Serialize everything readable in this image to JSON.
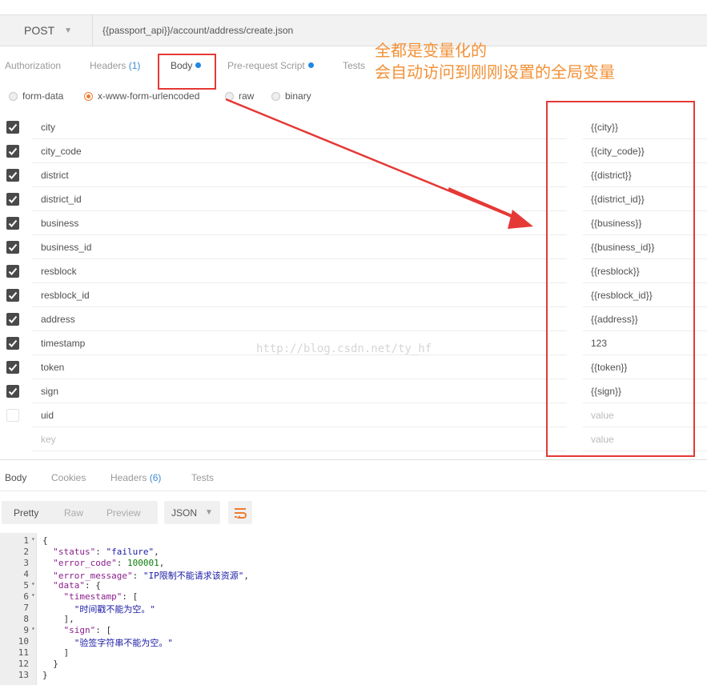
{
  "request": {
    "method": "POST",
    "url": "{{passport_api}}/account/address/create.json"
  },
  "request_tabs": [
    {
      "label": "Authorization",
      "count": "",
      "dot": false,
      "active": false
    },
    {
      "label": "Headers",
      "count": "(1)",
      "dot": false,
      "active": false
    },
    {
      "label": "Body",
      "count": "",
      "dot": true,
      "active": true
    },
    {
      "label": "Pre-request Script",
      "count": "",
      "dot": true,
      "active": false
    },
    {
      "label": "Tests",
      "count": "",
      "dot": false,
      "active": false
    }
  ],
  "body_types": [
    {
      "label": "form-data",
      "selected": false
    },
    {
      "label": "x-www-form-urlencoded",
      "selected": true
    },
    {
      "label": "raw",
      "selected": false
    },
    {
      "label": "binary",
      "selected": false
    }
  ],
  "params": [
    {
      "key": "city",
      "value": "{{city}}",
      "checked": true
    },
    {
      "key": "city_code",
      "value": "{{city_code}}",
      "checked": true
    },
    {
      "key": "district",
      "value": "{{district}}",
      "checked": true
    },
    {
      "key": "district_id",
      "value": "{{district_id}}",
      "checked": true
    },
    {
      "key": "business",
      "value": "{{business}}",
      "checked": true
    },
    {
      "key": "business_id",
      "value": "{{business_id}}",
      "checked": true
    },
    {
      "key": "resblock",
      "value": "{{resblock}}",
      "checked": true
    },
    {
      "key": "resblock_id",
      "value": "{{resblock_id}}",
      "checked": true
    },
    {
      "key": "address",
      "value": "{{address}}",
      "checked": true
    },
    {
      "key": "timestamp",
      "value": "123",
      "checked": true
    },
    {
      "key": "token",
      "value": "{{token}}",
      "checked": true
    },
    {
      "key": "sign",
      "value": "{{sign}}",
      "checked": true
    },
    {
      "key": "uid",
      "value": "",
      "value_placeholder": "value",
      "checked": false
    },
    {
      "key": "",
      "key_placeholder": "key",
      "value": "",
      "value_placeholder": "value",
      "checked": false,
      "new_row": true
    }
  ],
  "watermark": "http://blog.csdn.net/ty_hf",
  "annotation": {
    "line1": "全都是变量化的",
    "line2": "会自动访问到刚刚设置的全局变量",
    "text_color": "#f29137",
    "box_color": "#e53935"
  },
  "response_tabs": [
    {
      "label": "Body",
      "count": "",
      "active": true
    },
    {
      "label": "Cookies",
      "count": "",
      "active": false
    },
    {
      "label": "Headers",
      "count": "(6)",
      "active": false
    },
    {
      "label": "Tests",
      "count": "",
      "active": false
    }
  ],
  "view_modes": [
    {
      "label": "Pretty",
      "active": true
    },
    {
      "label": "Raw",
      "active": false
    },
    {
      "label": "Preview",
      "active": false
    }
  ],
  "format": "JSON",
  "code_lines": [
    {
      "n": "1",
      "fold": true,
      "parts": [
        [
          "p",
          "{"
        ]
      ]
    },
    {
      "n": "2",
      "fold": false,
      "parts": [
        [
          "p",
          "  "
        ],
        [
          "k",
          "\"status\""
        ],
        [
          "p",
          ": "
        ],
        [
          "s",
          "\"failure\""
        ],
        [
          "p",
          ","
        ]
      ]
    },
    {
      "n": "3",
      "fold": false,
      "parts": [
        [
          "p",
          "  "
        ],
        [
          "k",
          "\"error_code\""
        ],
        [
          "p",
          ": "
        ],
        [
          "n",
          "100001"
        ],
        [
          "p",
          ","
        ]
      ]
    },
    {
      "n": "4",
      "fold": false,
      "parts": [
        [
          "p",
          "  "
        ],
        [
          "k",
          "\"error_message\""
        ],
        [
          "p",
          ": "
        ],
        [
          "s",
          "\"IP限制不能请求该资源\""
        ],
        [
          "p",
          ","
        ]
      ]
    },
    {
      "n": "5",
      "fold": true,
      "parts": [
        [
          "p",
          "  "
        ],
        [
          "k",
          "\"data\""
        ],
        [
          "p",
          ": {"
        ]
      ]
    },
    {
      "n": "6",
      "fold": true,
      "parts": [
        [
          "p",
          "    "
        ],
        [
          "k",
          "\"timestamp\""
        ],
        [
          "p",
          ": ["
        ]
      ]
    },
    {
      "n": "7",
      "fold": false,
      "parts": [
        [
          "p",
          "      "
        ],
        [
          "s",
          "\"时间戳不能为空。\""
        ]
      ]
    },
    {
      "n": "8",
      "fold": false,
      "parts": [
        [
          "p",
          "    ],"
        ]
      ]
    },
    {
      "n": "9",
      "fold": true,
      "parts": [
        [
          "p",
          "    "
        ],
        [
          "k",
          "\"sign\""
        ],
        [
          "p",
          ": ["
        ]
      ]
    },
    {
      "n": "10",
      "fold": false,
      "parts": [
        [
          "p",
          "      "
        ],
        [
          "s",
          "\"验签字符串不能为空。\""
        ]
      ]
    },
    {
      "n": "11",
      "fold": false,
      "parts": [
        [
          "p",
          "    ]"
        ]
      ]
    },
    {
      "n": "12",
      "fold": false,
      "parts": [
        [
          "p",
          "  }"
        ]
      ]
    },
    {
      "n": "13",
      "fold": false,
      "parts": [
        [
          "p",
          "}"
        ]
      ]
    }
  ]
}
